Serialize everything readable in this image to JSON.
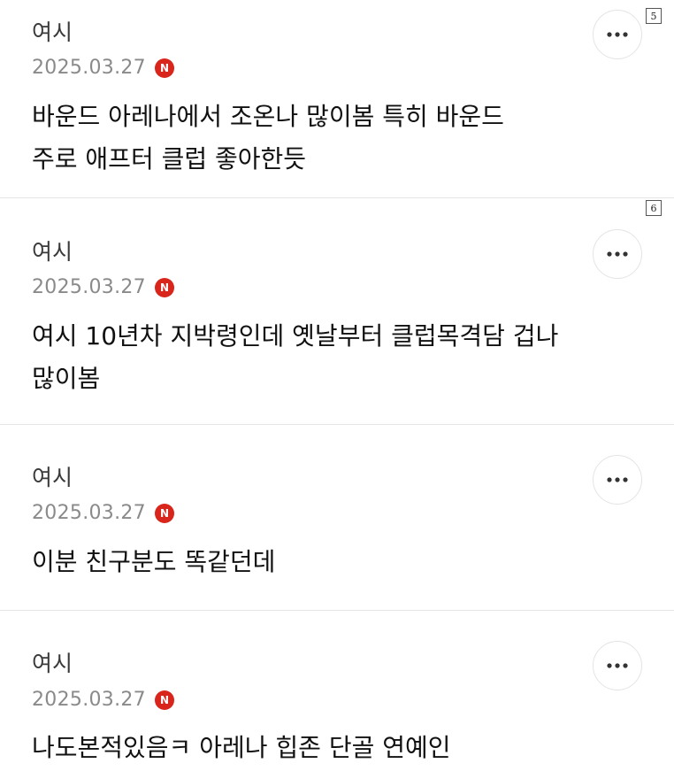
{
  "comments": [
    {
      "index_label": "5",
      "author": "여시",
      "date": "2025.03.27",
      "badge": "N",
      "text": "바운드 아레나에서 조온나 많이봄 특히 바운드\n주로 애프터 클럽 좋아한듯",
      "more_icon": "more-horizontal-icon"
    },
    {
      "index_label": "6",
      "author": "여시",
      "date": "2025.03.27",
      "badge": "N",
      "text": "여시 10년차 지박령인데 옛날부터 클럽목격담 겁나\n많이봄",
      "more_icon": "more-horizontal-icon"
    },
    {
      "index_label": "",
      "author": "여시",
      "date": "2025.03.27",
      "badge": "N",
      "text": "이분 친구분도 똑같던데",
      "more_icon": "more-horizontal-icon"
    },
    {
      "index_label": "",
      "author": "여시",
      "date": "2025.03.27",
      "badge": "N",
      "text": "나도본적있음ㅋ 아레나 힙존 단골 연예인",
      "more_icon": "more-horizontal-icon"
    }
  ],
  "colors": {
    "badge_red": "#d9261c",
    "date_gray": "#8a8a8a",
    "divider": "#e6e6e6"
  }
}
